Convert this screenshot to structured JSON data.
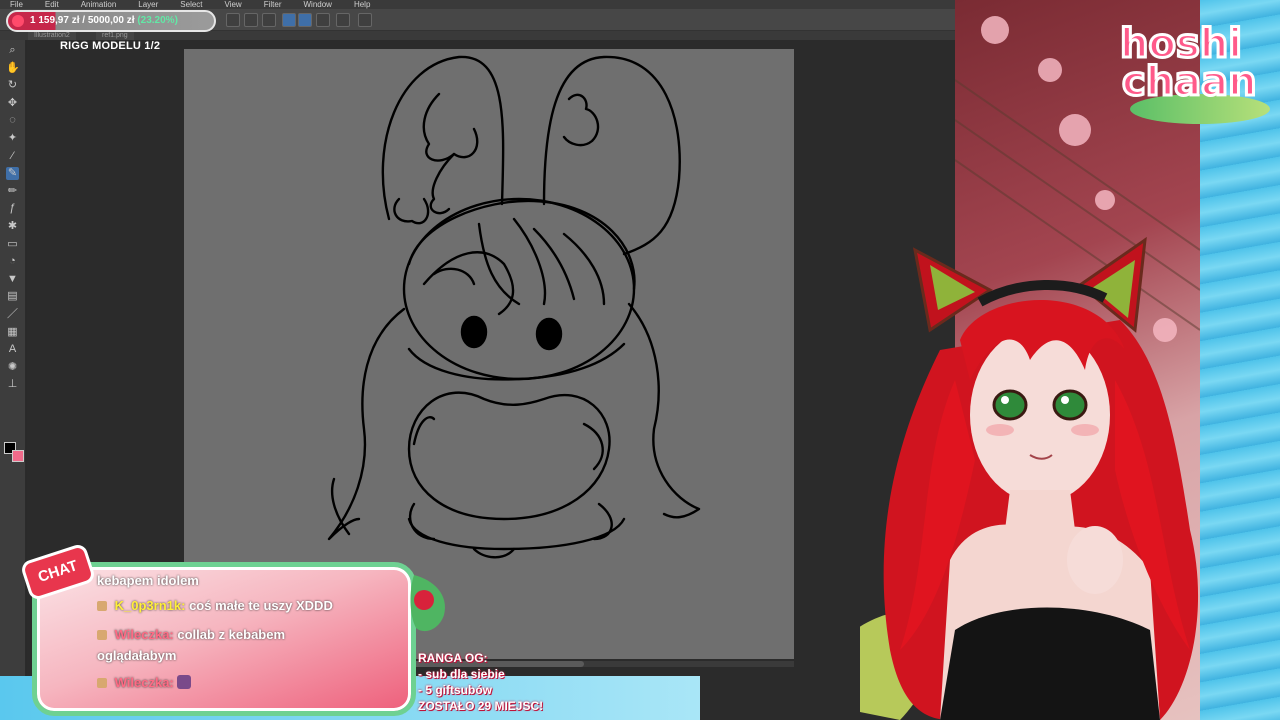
{
  "menu": {
    "items": [
      "File",
      "Edit",
      "Animation",
      "Layer",
      "Select",
      "View",
      "Filter",
      "Window",
      "Help"
    ]
  },
  "goal": {
    "current": "1 159,97 zł",
    "separator": "/",
    "target": "5000,00 zł",
    "percent": "(23.20%)",
    "progress": 0.232
  },
  "tabs": [
    "Illustration2",
    "ref1.png"
  ],
  "document": {
    "title": "RIGG MODELU 1/2"
  },
  "tools": [
    "magnifier-icon",
    "hand-icon",
    "rotate-icon",
    "move-icon",
    "lasso-icon",
    "wand-icon",
    "eyedropper-icon",
    "pen-icon",
    "pencil-icon",
    "brush-icon",
    "airbrush-icon",
    "eraser-icon",
    "blend-icon",
    "fill-icon",
    "gradient-icon",
    "figure-icon",
    "frame-icon",
    "text-icon",
    "balloon-icon",
    "ruler-icon"
  ],
  "chat": {
    "tag": "CHAT",
    "messages": [
      {
        "user": "",
        "text": "kebapem idolem"
      },
      {
        "user": "K_0p3rn1k:",
        "text": "coś małe te uszy XDDD"
      },
      {
        "user": "Wileczka:",
        "text": "collab z kebabem"
      },
      {
        "user": "",
        "text": "oglądałabym"
      },
      {
        "user": "Wileczka:",
        "text": ""
      }
    ]
  },
  "rank": {
    "title": "RANGA OG:",
    "lines": [
      "- sub dla siebie",
      "- 5 giftsubów",
      "ZOSTAŁO 29 MIEJSC!"
    ]
  },
  "logo": {
    "line1": "hoshi",
    "line2": "chaan"
  },
  "colors": {
    "accent": "#ff5a8a",
    "chat_border": "#6ed192",
    "canvas": "#6f6f6f",
    "goal_fill": "#c6274a"
  }
}
